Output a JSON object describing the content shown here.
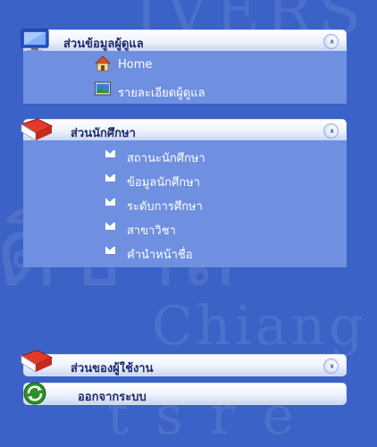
{
  "admin_section": {
    "title": "ส่วนข้อมูลผู้ดูแล",
    "toggle": "«",
    "items": [
      {
        "label": "Home",
        "icon": "home-icon"
      },
      {
        "label": "รายละเอียดผู้ดูแล",
        "icon": "picture-icon"
      }
    ]
  },
  "student_section": {
    "title": "ส่วนนักศึกษา",
    "toggle": "«",
    "items": [
      {
        "label": "สถานะนักศึกษา",
        "icon": "mail-icon"
      },
      {
        "label": "ข้อมูลนักศึกษา",
        "icon": "mail-icon"
      },
      {
        "label": "ระดับการศึกษา",
        "icon": "mail-icon"
      },
      {
        "label": "สาขาวิชา",
        "icon": "mail-icon"
      },
      {
        "label": "คำนำหน้าชื่อ",
        "icon": "mail-icon"
      }
    ]
  },
  "user_section": {
    "title": "ส่วนของผู้ใช้งาน",
    "toggle": "»"
  },
  "logout": {
    "title": "ออกจากระบบ"
  },
  "colors": {
    "background": "#3b62c6",
    "panel_body": "#6f8fe1",
    "header_text": "#1d2a6b"
  }
}
